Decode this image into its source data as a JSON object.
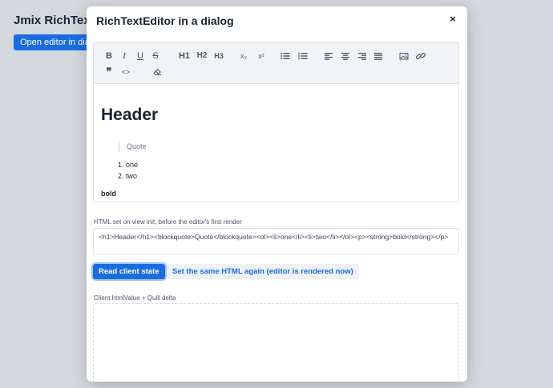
{
  "background": {
    "title": "Jmix RichTextEdi",
    "open_button_label": "Open editor in dialog"
  },
  "dialog": {
    "title": "RichTextEditor in a dialog",
    "close_label": "×"
  },
  "toolbar": {
    "items": [
      {
        "name": "bold-icon",
        "label": "B"
      },
      {
        "name": "italic-icon",
        "label": "I"
      },
      {
        "name": "underline-icon",
        "label": "U"
      },
      {
        "name": "strikethrough-icon",
        "label": "S"
      },
      {
        "name": "h1-button",
        "label": "H1"
      },
      {
        "name": "h2-button",
        "label": "H2"
      },
      {
        "name": "h3-button",
        "label": "H3"
      },
      {
        "name": "subscript-icon",
        "label": "x₂"
      },
      {
        "name": "superscript-icon",
        "label": "x²"
      },
      {
        "name": "ordered-list-icon",
        "label": ""
      },
      {
        "name": "bullet-list-icon",
        "label": ""
      },
      {
        "name": "align-left-icon",
        "label": ""
      },
      {
        "name": "align-center-icon",
        "label": ""
      },
      {
        "name": "align-right-icon",
        "label": ""
      },
      {
        "name": "align-justify-icon",
        "label": ""
      },
      {
        "name": "image-icon",
        "label": ""
      },
      {
        "name": "link-icon",
        "label": ""
      },
      {
        "name": "blockquote-icon",
        "label": "❞"
      },
      {
        "name": "code-block-icon",
        "label": "<>"
      },
      {
        "name": "clear-format-icon",
        "label": ""
      }
    ]
  },
  "content": {
    "header": "Header",
    "quote": "Quote",
    "list_items": [
      "1. one",
      "2. two"
    ],
    "bold": "bold"
  },
  "html_field": {
    "label": "HTML set on view init, before the editor's first render",
    "value": "<h1>Header</h1><blockquote>Quote</blockquote><ol><li>one</li><li>two</li></ol><p><strong>bold</strong></p>"
  },
  "buttons": {
    "read_client_state": "Read client state",
    "set_same_html": "Set the same HTML again (editor is rendered now)"
  },
  "result_field": {
    "label": "Client htmlValue + Quill delta",
    "value": ""
  },
  "colors": {
    "accent": "#1a6de0",
    "background": "#d5d9df",
    "text": "#1a2432"
  }
}
